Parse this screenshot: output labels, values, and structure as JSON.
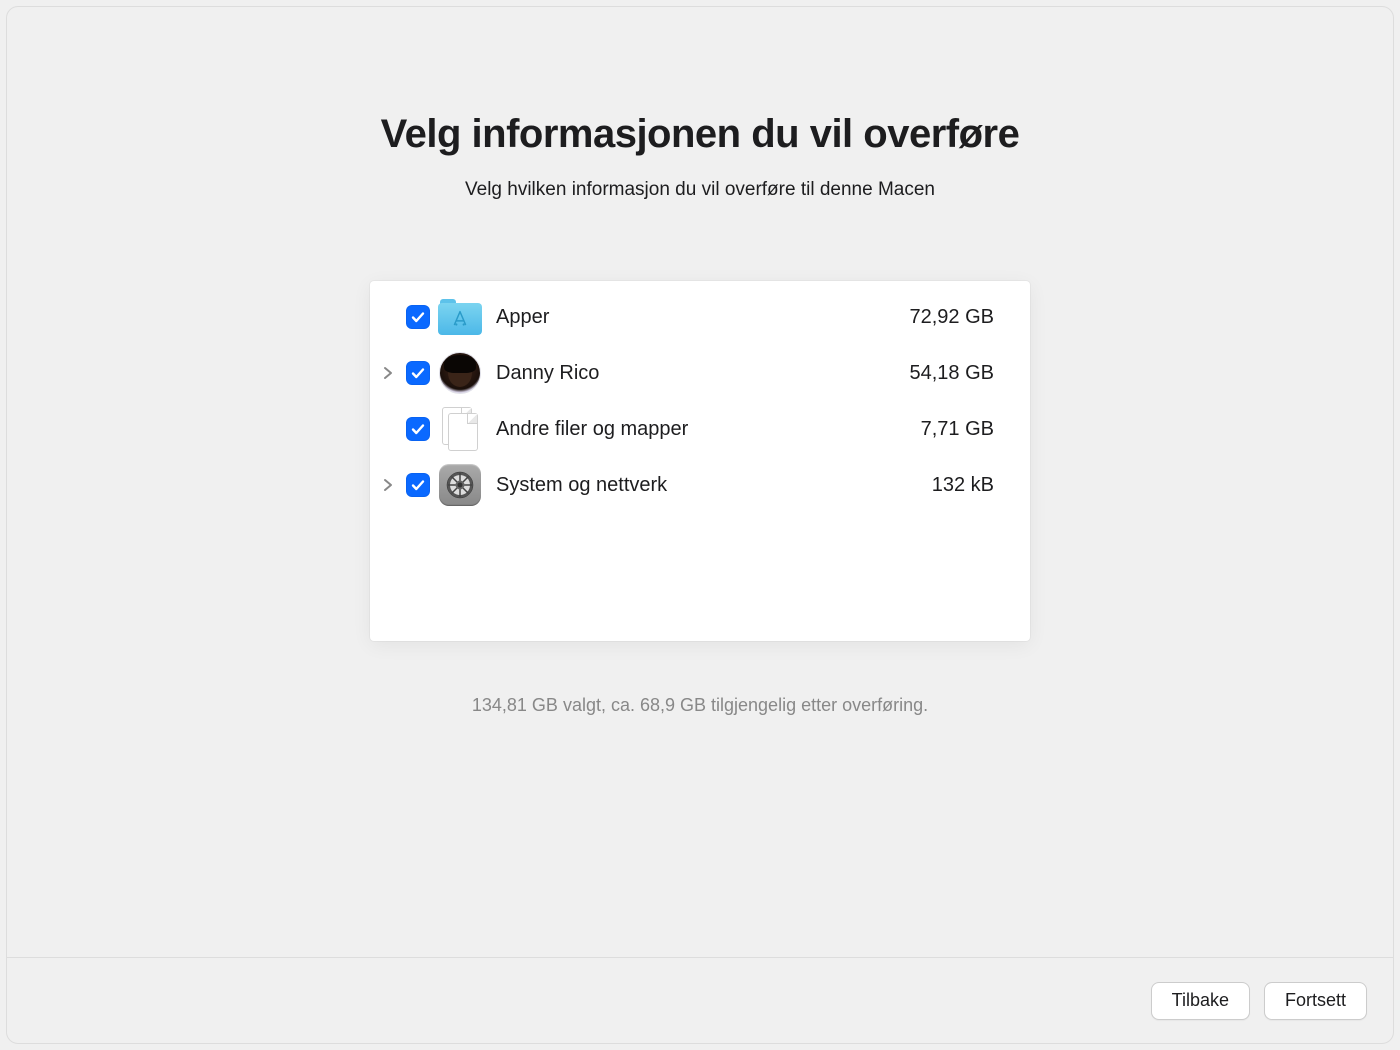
{
  "header": {
    "title": "Velg informasjonen du vil overføre",
    "subtitle": "Velg hvilken informasjon du vil overføre til denne Macen"
  },
  "items": [
    {
      "label": "Apper",
      "size": "72,92 GB",
      "expandable": false,
      "icon": "apps-folder"
    },
    {
      "label": "Danny Rico",
      "size": "54,18 GB",
      "expandable": true,
      "icon": "avatar"
    },
    {
      "label": "Andre filer og mapper",
      "size": "7,71 GB",
      "expandable": false,
      "icon": "files"
    },
    {
      "label": "System og nettverk",
      "size": "132 kB",
      "expandable": true,
      "icon": "gear"
    }
  ],
  "status": "134,81 GB valgt, ca. 68,9 GB tilgjengelig etter overføring.",
  "buttons": {
    "back": "Tilbake",
    "continue": "Fortsett"
  }
}
